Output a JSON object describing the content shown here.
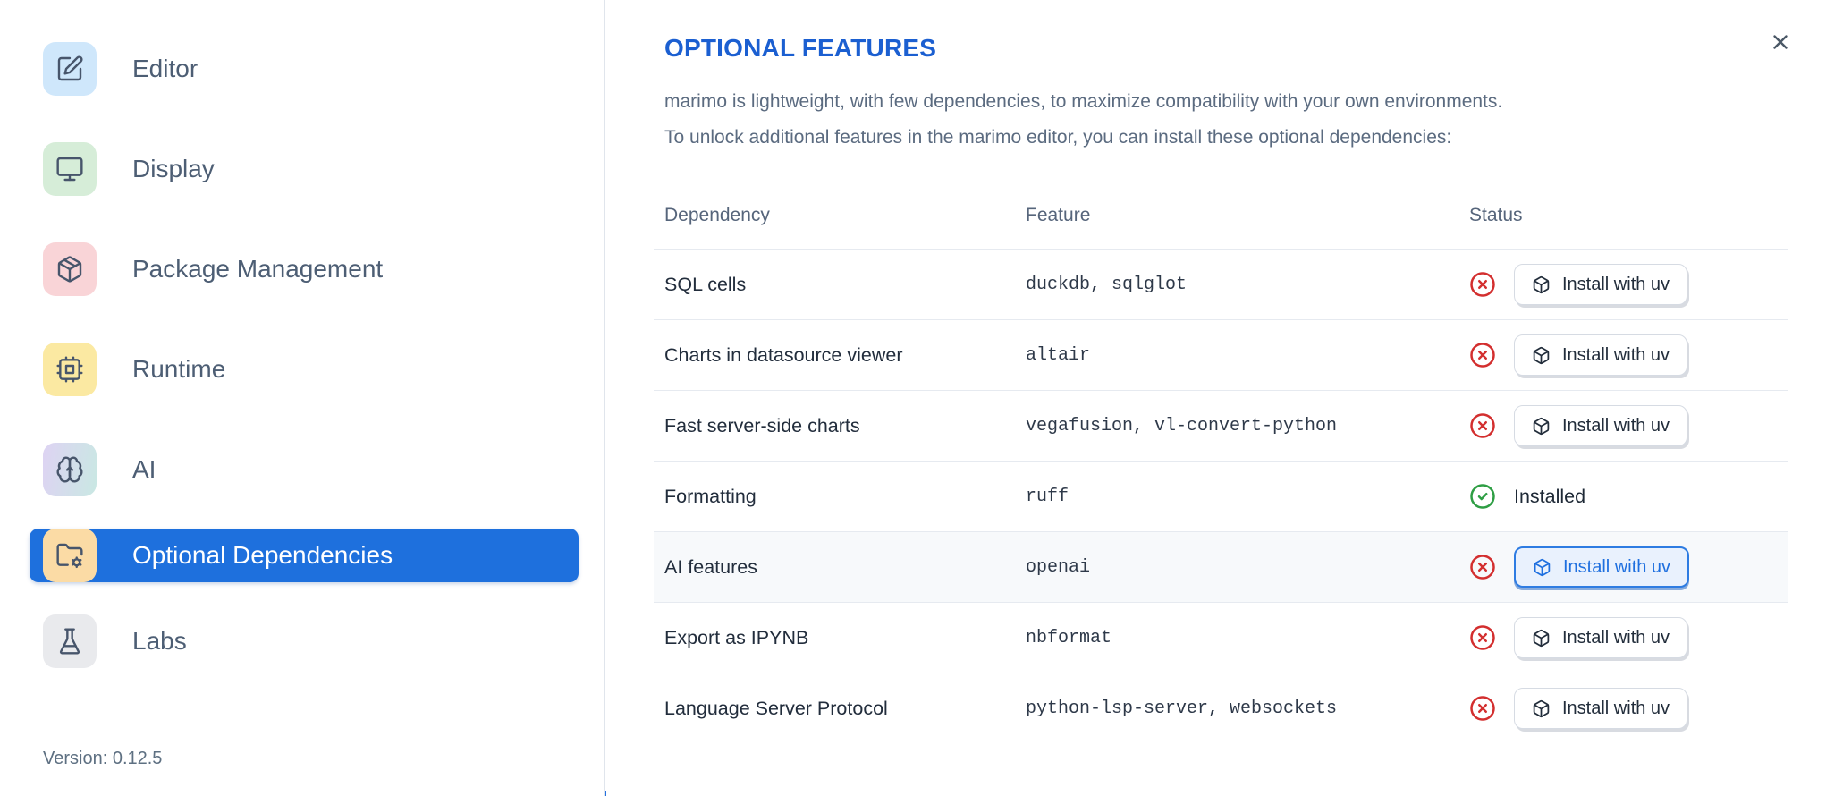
{
  "sidebar": {
    "items": [
      {
        "label": "Editor",
        "slug": "editor",
        "icon": "edit-icon",
        "tile_bg": "#cfe7fb"
      },
      {
        "label": "Display",
        "slug": "display",
        "icon": "monitor-icon",
        "tile_bg": "#d6edd8"
      },
      {
        "label": "Package Management",
        "slug": "package-management",
        "icon": "package-icon",
        "tile_bg": "#f9d4d7"
      },
      {
        "label": "Runtime",
        "slug": "runtime",
        "icon": "cpu-icon",
        "tile_bg": "#fbe9a2"
      },
      {
        "label": "AI",
        "slug": "ai",
        "icon": "brain-icon",
        "tile_bg": "linear-gradient(100deg,#ded3f3 0%,#c9e8e3 100%)"
      },
      {
        "label": "Optional Dependencies",
        "slug": "optional-dependencies",
        "icon": "folder-cog-icon",
        "tile_bg": "#fbdba5",
        "selected": true
      },
      {
        "label": "Labs",
        "slug": "labs",
        "icon": "flask-icon",
        "tile_bg": "#e9eaed"
      }
    ],
    "version_label": "Version: 0.12.5"
  },
  "dialog": {
    "title": "OPTIONAL FEATURES",
    "description_lines": [
      "marimo is lightweight, with few dependencies, to maximize compatibility with your own environments.",
      "To unlock additional features in the marimo editor, you can install these optional dependencies:"
    ]
  },
  "table": {
    "headers": [
      "Dependency",
      "Feature",
      "Status"
    ],
    "install_button_label": "Install with uv",
    "installed_label": "Installed",
    "rows": [
      {
        "dependency": "SQL cells",
        "feature": "duckdb, sqlglot",
        "status": "missing"
      },
      {
        "dependency": "Charts in datasource viewer",
        "feature": "altair",
        "status": "missing"
      },
      {
        "dependency": "Fast server-side charts",
        "feature": "vegafusion, vl-convert-python",
        "status": "missing"
      },
      {
        "dependency": "Formatting",
        "feature": "ruff",
        "status": "installed"
      },
      {
        "dependency": "AI features",
        "feature": "openai",
        "status": "missing",
        "focused": true
      },
      {
        "dependency": "Export as IPYNB",
        "feature": "nbformat",
        "status": "missing"
      },
      {
        "dependency": "Language Server Protocol",
        "feature": "python-lsp-server, websockets",
        "status": "missing"
      }
    ]
  },
  "colors": {
    "accent_blue": "#1e70dd",
    "title_blue": "#1b5fd1",
    "status_red": "#d32f2f",
    "status_green": "#2e9e44",
    "focus_ring": "#2e7ce2",
    "bottom_strip_blue": "#2471e0"
  }
}
